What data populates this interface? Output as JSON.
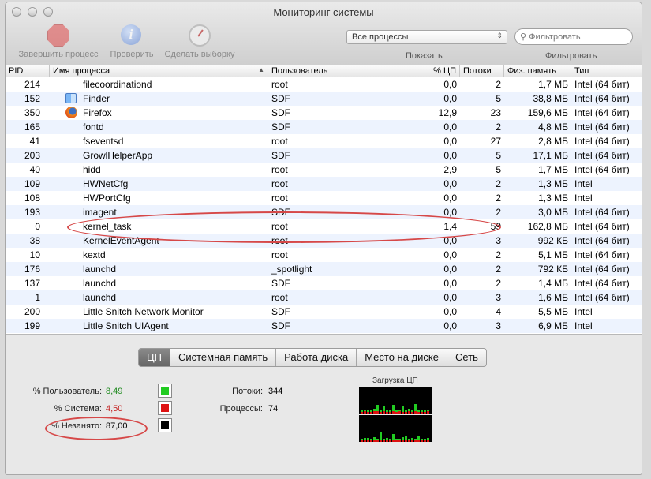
{
  "window": {
    "title": "Мониторинг системы"
  },
  "toolbar": {
    "quit_label": "Завершить процесс",
    "inspect_label": "Проверить",
    "sample_label": "Сделать выборку",
    "show_select_value": "Все процессы",
    "show_label": "Показать",
    "search_placeholder": "Фильтровать",
    "filter_label": "Фильтровать"
  },
  "table": {
    "headers": {
      "pid": "PID",
      "name": "Имя процесса",
      "user": "Пользователь",
      "cpu": "% ЦП",
      "threads": "Потоки",
      "mem": "Физ. память",
      "type": "Тип"
    },
    "rows": [
      {
        "pid": "214",
        "name": "filecoordinationd",
        "user": "root",
        "cpu": "0,0",
        "threads": "2",
        "mem": "1,7 МБ",
        "type": "Intel (64 бит)",
        "icon": ""
      },
      {
        "pid": "152",
        "name": "Finder",
        "user": "SDF",
        "cpu": "0,0",
        "threads": "5",
        "mem": "38,8 МБ",
        "type": "Intel (64 бит)",
        "icon": "finder-icon"
      },
      {
        "pid": "350",
        "name": "Firefox",
        "user": "SDF",
        "cpu": "12,9",
        "threads": "23",
        "mem": "159,6 МБ",
        "type": "Intel (64 бит)",
        "icon": "firefox-icon"
      },
      {
        "pid": "165",
        "name": "fontd",
        "user": "SDF",
        "cpu": "0,0",
        "threads": "2",
        "mem": "4,8 МБ",
        "type": "Intel (64 бит)",
        "icon": ""
      },
      {
        "pid": "41",
        "name": "fseventsd",
        "user": "root",
        "cpu": "0,0",
        "threads": "27",
        "mem": "2,8 МБ",
        "type": "Intel (64 бит)",
        "icon": ""
      },
      {
        "pid": "203",
        "name": "GrowlHelperApp",
        "user": "SDF",
        "cpu": "0,0",
        "threads": "5",
        "mem": "17,1 МБ",
        "type": "Intel (64 бит)",
        "icon": ""
      },
      {
        "pid": "40",
        "name": "hidd",
        "user": "root",
        "cpu": "2,9",
        "threads": "5",
        "mem": "1,7 МБ",
        "type": "Intel (64 бит)",
        "icon": ""
      },
      {
        "pid": "109",
        "name": "HWNetCfg",
        "user": "root",
        "cpu": "0,0",
        "threads": "2",
        "mem": "1,3 МБ",
        "type": "Intel",
        "icon": ""
      },
      {
        "pid": "108",
        "name": "HWPortCfg",
        "user": "root",
        "cpu": "0,0",
        "threads": "2",
        "mem": "1,3 МБ",
        "type": "Intel",
        "icon": ""
      },
      {
        "pid": "193",
        "name": "imagent",
        "user": "SDF",
        "cpu": "0,0",
        "threads": "2",
        "mem": "3,0 МБ",
        "type": "Intel (64 бит)",
        "icon": ""
      },
      {
        "pid": "0",
        "name": "kernel_task",
        "user": "root",
        "cpu": "1,4",
        "threads": "59",
        "mem": "162,8 МБ",
        "type": "Intel (64 бит)",
        "icon": ""
      },
      {
        "pid": "38",
        "name": "KernelEventAgent",
        "user": "root",
        "cpu": "0,0",
        "threads": "3",
        "mem": "992 КБ",
        "type": "Intel (64 бит)",
        "icon": ""
      },
      {
        "pid": "10",
        "name": "kextd",
        "user": "root",
        "cpu": "0,0",
        "threads": "2",
        "mem": "5,1 МБ",
        "type": "Intel (64 бит)",
        "icon": ""
      },
      {
        "pid": "176",
        "name": "launchd",
        "user": "_spotlight",
        "cpu": "0,0",
        "threads": "2",
        "mem": "792 КБ",
        "type": "Intel (64 бит)",
        "icon": ""
      },
      {
        "pid": "137",
        "name": "launchd",
        "user": "SDF",
        "cpu": "0,0",
        "threads": "2",
        "mem": "1,4 МБ",
        "type": "Intel (64 бит)",
        "icon": ""
      },
      {
        "pid": "1",
        "name": "launchd",
        "user": "root",
        "cpu": "0,0",
        "threads": "3",
        "mem": "1,6 МБ",
        "type": "Intel (64 бит)",
        "icon": ""
      },
      {
        "pid": "200",
        "name": "Little Snitch Network Monitor",
        "user": "SDF",
        "cpu": "0,0",
        "threads": "4",
        "mem": "5,5 МБ",
        "type": "Intel",
        "icon": ""
      },
      {
        "pid": "199",
        "name": "Little Snitch UIAgent",
        "user": "SDF",
        "cpu": "0,0",
        "threads": "3",
        "mem": "6,9 МБ",
        "type": "Intel",
        "icon": ""
      }
    ]
  },
  "tabs": [
    "ЦП",
    "Системная память",
    "Работа диска",
    "Место на диске",
    "Сеть"
  ],
  "active_tab": "ЦП",
  "cpu_panel": {
    "user_label": "% Пользователь:",
    "user_value": "8,49",
    "system_label": "% Система:",
    "system_value": "4,50",
    "idle_label": "% Незанято:",
    "idle_value": "87,00",
    "threads_label": "Потоки:",
    "threads_value": "344",
    "processes_label": "Процессы:",
    "processes_value": "74",
    "graph_title": "Загрузка ЦП",
    "user_color": "#22cc22",
    "system_color": "#dd1111",
    "idle_color": "#000000",
    "user_value_color": "#1e8a1e",
    "system_value_color": "#c21a1a"
  }
}
